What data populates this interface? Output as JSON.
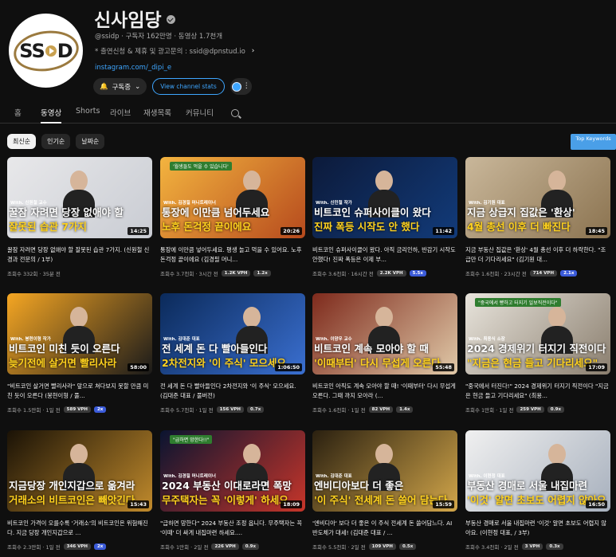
{
  "channel": {
    "name": "신사임당",
    "avatar_text": "SSiD",
    "meta": "@ssidp · 구독자 162만명 · 동영상 1.7천개",
    "description": "* 출연신청 & 제휴 및 광고문의 : ssid@dpnstud.io",
    "link": "instagram.com/_dipi_e",
    "subscribe_label": "구독중",
    "stats_button": "View channel stats"
  },
  "tabs": [
    {
      "label": "홈",
      "active": false
    },
    {
      "label": "동영상",
      "active": true
    },
    {
      "label": "Shorts",
      "active": false
    },
    {
      "label": "라이브",
      "active": false
    },
    {
      "label": "재생목록",
      "active": false
    },
    {
      "label": "커뮤니티",
      "active": false
    }
  ],
  "chips": [
    "최신순",
    "인기순",
    "날짜순"
  ],
  "top_keywords": "Top Keywords",
  "videos": [
    {
      "with": "With. 신원철 교수",
      "line1": "꿀잠 자려면 당장 없애야 할",
      "line2": "잘못된 습관 7가지",
      "duration": "14:25",
      "title": "꿀잠 자려면 당장 없애야 할 잘못된 습관 7가지. (신원철 신경과 전문의 / 1부)",
      "views": "조회수 332회 · 35분 전",
      "vph": "",
      "mult": ""
    },
    {
      "with": "With. 김경필 머니트레이너",
      "line1": "통장에 이만큼 넘어두세요",
      "line2": "노후 돈걱정 끝이에요",
      "duration": "20:26",
      "title": "통장에 이만큼 넣어두세요. 평생 놀고 먹을 수 있어요. 노후 돈걱정 끝이에요 (김경필 머니...",
      "views": "조회수 3.7천회 · 3시간 전",
      "vph": "1.2K VPH",
      "mult": "1.2x",
      "tag": "'월생들도 먹을 수 있습니다'"
    },
    {
      "with": "With. 신민철 작가",
      "line1": "비트코인 슈퍼사이클이 왔다",
      "line2": "진짜 폭등 시작도 안 했다",
      "duration": "11:42",
      "title": "비트코인 슈퍼사이클이 왔다. 아직 금리인하, 반감기 시작도 안했다! 진짜 폭등은 이제 부...",
      "views": "조회수 3.6천회 · 16시간 전",
      "vph": "2.2K VPH",
      "mult": "5.5x",
      "hi": true
    },
    {
      "with": "With. 김기원 대표",
      "line1": "지금 상급지 집값은 '환상'",
      "line2": "4월 총선 이후 더 빠진다",
      "duration": "18:45",
      "title": "지금 부동산 집값은 '환상' 4월 총선 이후 더 하락한다. \"조급만 더 기다리세요\" (김기원 대...",
      "views": "조회수 1.6천회 · 23시간 전",
      "vph": "714 VPH",
      "mult": "2.1x",
      "hi": true
    },
    {
      "with": "With. 봉현이형 작가",
      "line1": "비트코인 미친 듯이 오른다",
      "line2": "늦기전에 살거면 빨리사라",
      "duration": "58:00",
      "title": "\"비트코인 살거면 빨리사라\" 앞으로 쳐다보지 못할 만큼 미친 듯이 오른다 (봉현이형 / 풀...",
      "views": "조회수 1.5만회 · 1일 전",
      "vph": "589 VPH",
      "mult": "2x",
      "hi": true
    },
    {
      "with": "With. 김대준 대표",
      "line1": "전 세계 돈 다 빨아들인다",
      "line2": "2차전지와 '이 주식' 모으세요",
      "duration": "1:06:50",
      "title": "전 세계 돈 다 빨아들인다 2차전지와 '이 주식' 모으세요. (김대준 대표 / 풀버전)",
      "views": "조회수 5.7천회 · 1일 전",
      "vph": "156 VPH",
      "mult": "0.7x"
    },
    {
      "with": "With. 이양우 교수",
      "line1": "비트코인 계속 모아야 할 때",
      "line2": "'이때부터' 다시 무섭게 오른다",
      "duration": "55:48",
      "title": "비트코인 아직도 계속 모아야 할 때! '이때부터' 다시 무섭게 오른다. 그때 까지 모아라 (...",
      "views": "조회수 1.6천회 · 1일 전",
      "vph": "82 VPH",
      "mult": "1.4x"
    },
    {
      "with": "With. 최용식 소장",
      "line1": "2024 경제위기 터지기 직전이다",
      "line2": "\"지금은 현금 들고 기다리세요\"",
      "duration": "17:09",
      "title": "\"중국에서 터진다!\" 2024 경제위기 터지기 직전이다 \"지금은 현금 들고 기다리세요\" (최용...",
      "views": "조회수 1만회 · 1일 전",
      "vph": "259 VPH",
      "mult": "0.9x",
      "tag": "\"중국에서 빵하고 터지기 일보직전이다\""
    },
    {
      "with": "",
      "line1": "지금당장 개인지갑으로 옮겨라",
      "line2": "거래소의 비트코인은 빼앗긴다",
      "duration": "15:43",
      "title": "비트코인 가격이 오를수록 '거래소'의 비트코인은 위험해진다. 지금 당장 개인지갑으로 ...",
      "views": "조회수 2.3만회 · 1일 전",
      "vph": "346 VPH",
      "mult": "2x",
      "hi": true
    },
    {
      "with": "With. 김경필 머니트레이너",
      "line1": "2024 부동산 이대로라면 폭망",
      "line2": "무주택자는 꼭 '이렇게' 하세요",
      "duration": "18:09",
      "title": "\"급하면 망한다\" 2024 부동산 조정 옵니다. 무주택자는 꼭 '이때' 더 싸게 내집마련 하세요....",
      "views": "조회수 1만회 · 2일 전",
      "vph": "226 VPH",
      "mult": "0.9x",
      "tag": "\"급하면 망한다!!\""
    },
    {
      "with": "With. 김대준 대표",
      "line1": "엔비디아보다 더 좋은",
      "line2": "'이 주식' 전세계 돈 쓸어 담는다",
      "duration": "15:59",
      "title": "'엔비디아' 보다 더 좋은 이 주식 전세계 돈 쓸어담느다. AI 반도체가 대세! (김대준 대표 / ...",
      "views": "조회수 5.5천회 · 2일 전",
      "vph": "109 VPH",
      "mult": "0.5x"
    },
    {
      "with": "With. 이현정 대표",
      "line1": "부동산 경매로 서울 내집마련",
      "line2": "'이것' 알면 초보도 어렵지 않아요",
      "duration": "16:50",
      "title": "부동산 경매로 서울 내집마련 '이것' 알면 초보도 어렵지 않아요. (이현정 대표, / 3부)",
      "views": "조회수 3.4천회 · 2일 전",
      "vph": "3 VPH",
      "mult": "0.3x"
    }
  ]
}
